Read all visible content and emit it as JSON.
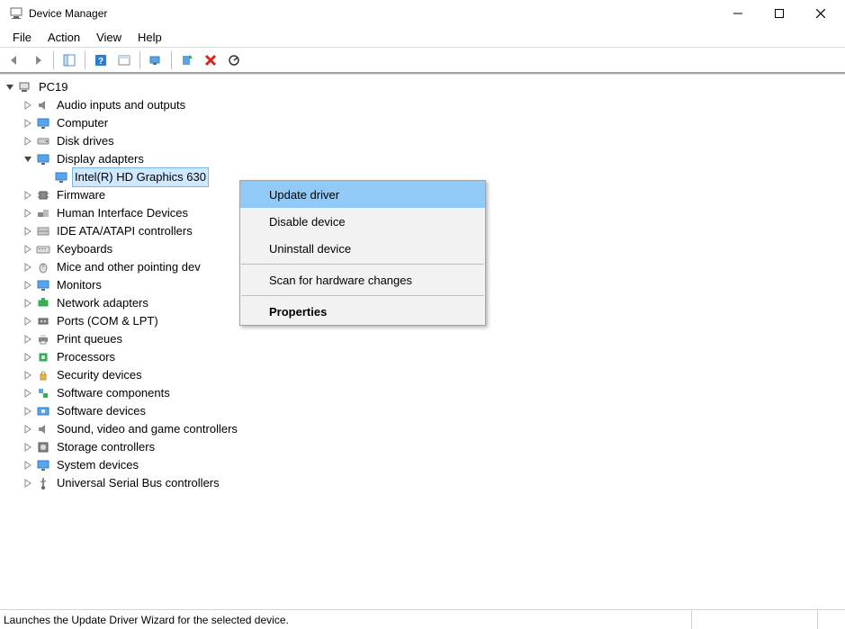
{
  "window": {
    "title": "Device Manager"
  },
  "menubar": {
    "file": "File",
    "action": "Action",
    "view": "View",
    "help": "Help"
  },
  "tree": {
    "root": "PC19",
    "items": [
      "Audio inputs and outputs",
      "Computer",
      "Disk drives",
      "Display adapters",
      "Firmware",
      "Human Interface Devices",
      "IDE ATA/ATAPI controllers",
      "Keyboards",
      "Mice and other pointing dev",
      "Monitors",
      "Network adapters",
      "Ports (COM & LPT)",
      "Print queues",
      "Processors",
      "Security devices",
      "Software components",
      "Software devices",
      "Sound, video and game controllers",
      "Storage controllers",
      "System devices",
      "Universal Serial Bus controllers"
    ],
    "display_child": "Intel(R) HD Graphics 630"
  },
  "context_menu": {
    "update": "Update driver",
    "disable": "Disable device",
    "uninstall": "Uninstall device",
    "scan": "Scan for hardware changes",
    "properties": "Properties"
  },
  "statusbar": {
    "text": "Launches the Update Driver Wizard for the selected device."
  }
}
